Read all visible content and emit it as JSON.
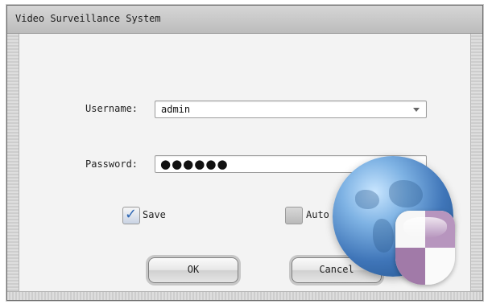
{
  "window": {
    "title": "Video Surveillance System"
  },
  "login": {
    "username_label": "Username:",
    "username_value": "admin",
    "password_label": "Password:",
    "password_mask": "●●●●●●",
    "save_label": "Save",
    "save_checked": true,
    "auto_label": "Auto",
    "auto_checked": false,
    "ok_label": "OK",
    "cancel_label": "Cancel"
  },
  "icons": {
    "dropdown": "chevron-down-icon",
    "save_check": "checkmark-icon",
    "logo": "globe-shield-icon"
  },
  "colors": {
    "title_bar": "#c9c9c9",
    "panel": "#f3f3f3",
    "checkmark": "#2f67b4",
    "globe": "#3f75b8",
    "shield_accent": "#b795be"
  }
}
